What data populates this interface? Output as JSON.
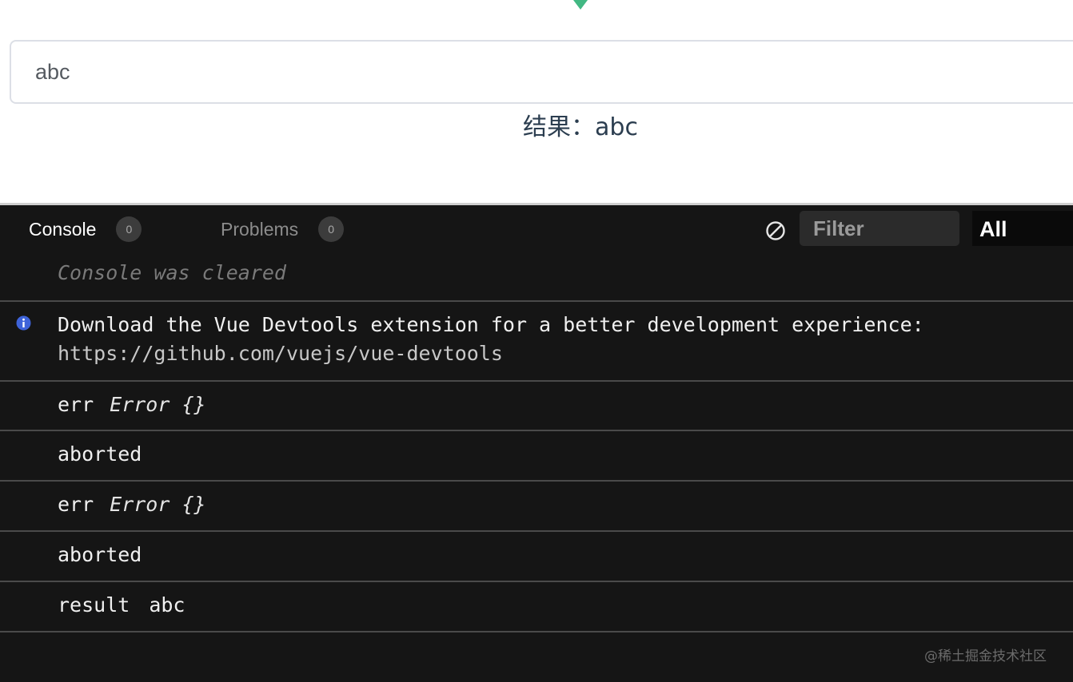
{
  "app": {
    "input_value": "abc",
    "result_text": "结果：abc",
    "accent_color": "#42b883"
  },
  "console_panel": {
    "tabs": [
      {
        "label": "Console",
        "count": "0"
      },
      {
        "label": "Problems",
        "count": "0"
      }
    ],
    "clear_icon": "block-icon",
    "filter_placeholder": "Filter",
    "level_select": "All",
    "logs": {
      "cleared": "Console was cleared",
      "info_line1": "Download the Vue Devtools extension for a better development experience:",
      "info_line2": "https://github.com/vuejs/vue-devtools",
      "rows": [
        {
          "label": "err",
          "detail": "Error {}"
        },
        {
          "label": "aborted"
        },
        {
          "label": "err",
          "detail": "Error {}"
        },
        {
          "label": "aborted"
        },
        {
          "label": "result",
          "value": "abc"
        }
      ]
    }
  },
  "watermark": "@稀土掘金技术社区"
}
